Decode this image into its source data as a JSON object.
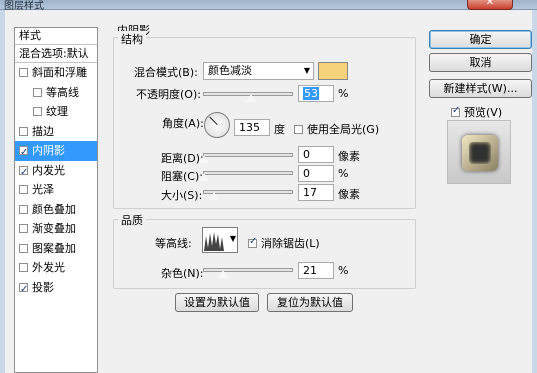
{
  "window": {
    "title": "图层样式"
  },
  "sidebar": {
    "header": "样式",
    "blend_options": "混合选项:默认",
    "items": [
      {
        "label": "斜面和浮雕",
        "checked": false,
        "indent": false,
        "selected": false
      },
      {
        "label": "等高线",
        "checked": false,
        "indent": true,
        "selected": false
      },
      {
        "label": "纹理",
        "checked": false,
        "indent": true,
        "selected": false
      },
      {
        "label": "描边",
        "checked": false,
        "indent": false,
        "selected": false
      },
      {
        "label": "内阴影",
        "checked": true,
        "indent": false,
        "selected": true
      },
      {
        "label": "内发光",
        "checked": true,
        "indent": false,
        "selected": false
      },
      {
        "label": "光泽",
        "checked": false,
        "indent": false,
        "selected": false
      },
      {
        "label": "颜色叠加",
        "checked": false,
        "indent": false,
        "selected": false
      },
      {
        "label": "渐变叠加",
        "checked": false,
        "indent": false,
        "selected": false
      },
      {
        "label": "图案叠加",
        "checked": false,
        "indent": false,
        "selected": false
      },
      {
        "label": "外发光",
        "checked": false,
        "indent": false,
        "selected": false
      },
      {
        "label": "投影",
        "checked": true,
        "indent": false,
        "selected": false
      }
    ]
  },
  "panel": {
    "title": "内阴影",
    "structure": {
      "legend": "结构",
      "blend_mode_label": "混合模式(B):",
      "blend_mode_value": "颜色减淡",
      "swatch_color": "#f6d27a",
      "opacity_label": "不透明度(O):",
      "opacity_value": "53",
      "opacity_unit": "%",
      "opacity_fraction": 0.53,
      "angle_label": "角度(A):",
      "angle_value": "135",
      "angle_unit": "度",
      "global_light_label": "使用全局光(G)",
      "global_light_checked": false,
      "distance_label": "距离(D):",
      "distance_value": "0",
      "distance_unit": "像素",
      "choke_label": "阻塞(C):",
      "choke_value": "0",
      "choke_unit": "%",
      "size_label": "大小(S):",
      "size_value": "17",
      "size_unit": "像素"
    },
    "quality": {
      "legend": "品质",
      "contour_label": "等高线:",
      "antialias_label": "消除锯齿(L)",
      "antialias_checked": true,
      "noise_label": "杂色(N):",
      "noise_value": "21",
      "noise_unit": "%"
    },
    "make_default": "设置为默认值",
    "reset_default": "复位为默认值"
  },
  "buttons": {
    "ok": "确定",
    "cancel": "取消",
    "new_style": "新建样式(W)...",
    "preview_label": "预览(V)",
    "preview_checked": true
  }
}
